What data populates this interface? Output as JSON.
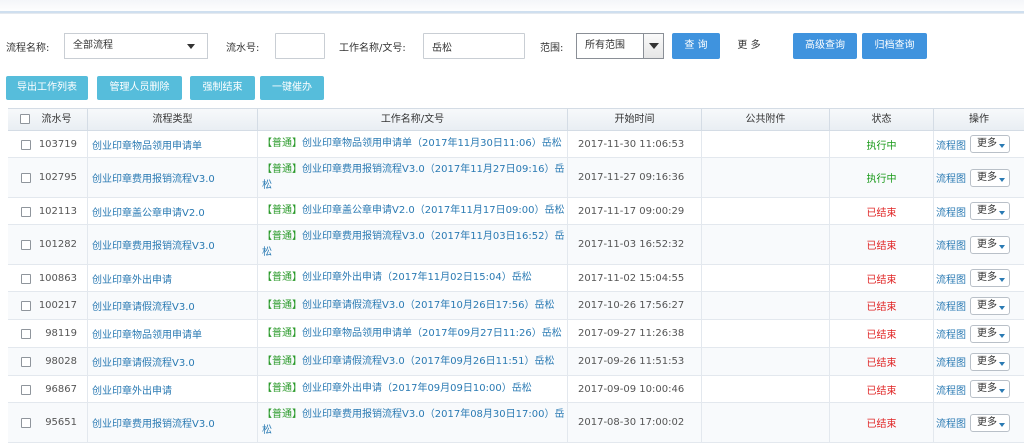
{
  "filters": {
    "flow_name_label": "流程名称:",
    "flow_name_value": "全部流程",
    "serial_label": "流水号:",
    "serial_value": "",
    "title_label": "工作名称/文号:",
    "title_value": "岳松",
    "scope_label": "范围:",
    "scope_value": "所有范围",
    "query_button": "查 询",
    "more_button": "更 多",
    "advanced_button": "高级查询",
    "archive_button": "归档查询"
  },
  "actions": {
    "export": "导出工作列表",
    "admin_delete": "管理人员删除",
    "force_end": "强制结束",
    "one_click_urge": "一键催办"
  },
  "table": {
    "headers": {
      "serial": "流水号",
      "flow_type": "流程类型",
      "work_title": "工作名称/文号",
      "start_time": "开始时间",
      "attachments": "公共附件",
      "status": "状态",
      "operation": "操作"
    },
    "flowchart_label": "流程图",
    "more_label": "更多",
    "rows": [
      {
        "serial": "103719",
        "type": "创业印章物品领用申请单",
        "tag": "【普通】",
        "title": "创业印章物品领用申请单（2017年11月30日11:06）岳松",
        "time": "2017-11-30 11:06:53",
        "status": "执行中",
        "state": "running"
      },
      {
        "serial": "102795",
        "type": "创业印章费用报销流程V3.0",
        "tag": "【普通】",
        "title": "创业印章费用报销流程V3.0（2017年11月27日09:16）岳松",
        "time": "2017-11-27 09:16:36",
        "status": "执行中",
        "state": "running"
      },
      {
        "serial": "102113",
        "type": "创业印章盖公章申请V2.0",
        "tag": "【普通】",
        "title": "创业印章盖公章申请V2.0（2017年11月17日09:00）岳松",
        "time": "2017-11-17 09:00:29",
        "status": "已结束",
        "state": "ended"
      },
      {
        "serial": "101282",
        "type": "创业印章费用报销流程V3.0",
        "tag": "【普通】",
        "title": "创业印章费用报销流程V3.0（2017年11月03日16:52）岳松",
        "time": "2017-11-03 16:52:32",
        "status": "已结束",
        "state": "ended"
      },
      {
        "serial": "100863",
        "type": "创业印章外出申请",
        "tag": "【普通】",
        "title": "创业印章外出申请（2017年11月02日15:04）岳松",
        "time": "2017-11-02 15:04:55",
        "status": "已结束",
        "state": "ended"
      },
      {
        "serial": "100217",
        "type": "创业印章请假流程V3.0",
        "tag": "【普通】",
        "title": "创业印章请假流程V3.0（2017年10月26日17:56）岳松",
        "time": "2017-10-26 17:56:27",
        "status": "已结束",
        "state": "ended"
      },
      {
        "serial": "98119",
        "type": "创业印章物品领用申请单",
        "tag": "【普通】",
        "title": "创业印章物品领用申请单（2017年09月27日11:26）岳松",
        "time": "2017-09-27 11:26:38",
        "status": "已结束",
        "state": "ended"
      },
      {
        "serial": "98028",
        "type": "创业印章请假流程V3.0",
        "tag": "【普通】",
        "title": "创业印章请假流程V3.0（2017年09月26日11:51）岳松",
        "time": "2017-09-26 11:51:53",
        "status": "已结束",
        "state": "ended"
      },
      {
        "serial": "96867",
        "type": "创业印章外出申请",
        "tag": "【普通】",
        "title": "创业印章外出申请（2017年09月09日10:00）岳松",
        "time": "2017-09-09 10:00:46",
        "status": "已结束",
        "state": "ended"
      },
      {
        "serial": "95651",
        "type": "创业印章费用报销流程V3.0",
        "tag": "【普通】",
        "title": "创业印章费用报销流程V3.0（2017年08月30日17:00）岳松",
        "time": "2017-08-30 17:00:02",
        "status": "已结束",
        "state": "ended"
      }
    ]
  }
}
